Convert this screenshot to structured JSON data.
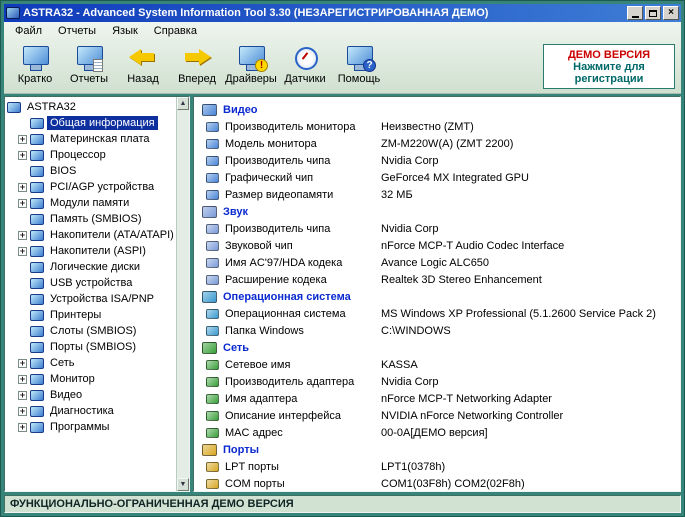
{
  "window": {
    "title": "ASTRA32 - Advanced System Information Tool 3.30 (НЕЗАРЕГИСТРИРОВАННАЯ ДЕМО)",
    "status_bar": "ФУНКЦИОНАЛЬНО-ОГРАНИЧЕННАЯ ДЕМО ВЕРСИЯ"
  },
  "menu": {
    "items": [
      {
        "label": "Файл"
      },
      {
        "label": "Отчеты"
      },
      {
        "label": "Язык"
      },
      {
        "label": "Справка"
      }
    ]
  },
  "toolbar": {
    "buttons": [
      {
        "label": "Кратко",
        "icon": "summary-icon",
        "type": "monitor"
      },
      {
        "label": "Отчеты",
        "icon": "reports-icon",
        "type": "monitor-page"
      },
      {
        "label": "Назад",
        "icon": "back-icon",
        "type": "arrow-left"
      },
      {
        "label": "Вперед",
        "icon": "forward-icon",
        "type": "arrow-right"
      },
      {
        "label": "Драйверы",
        "icon": "drivers-icon",
        "type": "monitor-warn"
      },
      {
        "label": "Датчики",
        "icon": "sensors-icon",
        "type": "gauge"
      },
      {
        "label": "Помощь",
        "icon": "help-icon",
        "type": "monitor-help"
      }
    ],
    "demo": {
      "line1": "ДЕМО ВЕРСИЯ",
      "line2": "Нажмите для регистрации"
    }
  },
  "tree": {
    "root": "ASTRA32",
    "items": [
      {
        "label": "Общая информация",
        "expandable": false,
        "selected": true
      },
      {
        "label": "Материнская плата",
        "expandable": true,
        "selected": false
      },
      {
        "label": "Процессор",
        "expandable": true,
        "selected": false
      },
      {
        "label": "BIOS",
        "expandable": false,
        "selected": false
      },
      {
        "label": "PCI/AGP устройства",
        "expandable": true,
        "selected": false
      },
      {
        "label": "Модули памяти",
        "expandable": true,
        "selected": false
      },
      {
        "label": "Память (SMBIOS)",
        "expandable": false,
        "selected": false
      },
      {
        "label": "Накопители (ATA/ATAPI)",
        "expandable": true,
        "selected": false
      },
      {
        "label": "Накопители (ASPI)",
        "expandable": true,
        "selected": false
      },
      {
        "label": "Логические диски",
        "expandable": false,
        "selected": false
      },
      {
        "label": "USB устройства",
        "expandable": false,
        "selected": false
      },
      {
        "label": "Устройства ISA/PNP",
        "expandable": false,
        "selected": false
      },
      {
        "label": "Принтеры",
        "expandable": false,
        "selected": false
      },
      {
        "label": "Слоты (SMBIOS)",
        "expandable": false,
        "selected": false
      },
      {
        "label": "Порты (SMBIOS)",
        "expandable": false,
        "selected": false
      },
      {
        "label": "Сеть",
        "expandable": true,
        "selected": false
      },
      {
        "label": "Монитор",
        "expandable": true,
        "selected": false
      },
      {
        "label": "Видео",
        "expandable": true,
        "selected": false
      },
      {
        "label": "Диагностика",
        "expandable": true,
        "selected": false
      },
      {
        "label": "Программы",
        "expandable": true,
        "selected": false
      }
    ]
  },
  "content": {
    "sections": [
      {
        "title": "Видео",
        "icon": "video",
        "icon_color": "#4a86d8",
        "rows": [
          {
            "label": "Производитель монитора",
            "value": "Неизвестно (ZMT)"
          },
          {
            "label": "Модель монитора",
            "value": "ZM-M220W(A) (ZMT 2200)"
          },
          {
            "label": "Производитель чипа",
            "value": "Nvidia Corp"
          },
          {
            "label": "Графический чип",
            "value": "GeForce4 MX Integrated GPU"
          },
          {
            "label": "Размер видеопамяти",
            "value": "32 МБ"
          }
        ]
      },
      {
        "title": "Звук",
        "icon": "sound",
        "icon_color": "#7a9ad8",
        "rows": [
          {
            "label": "Производитель чипа",
            "value": "Nvidia Corp"
          },
          {
            "label": "Звуковой чип",
            "value": "nForce MCP-T Audio Codec Interface"
          },
          {
            "label": "Имя AC'97/HDA кодека",
            "value": "Avance Logic ALC650"
          },
          {
            "label": "Расширение кодека",
            "value": "Realtek 3D Stereo Enhancement"
          }
        ]
      },
      {
        "title": "Операционная система",
        "icon": "os",
        "icon_color": "#3a9ad0",
        "rows": [
          {
            "label": "Операционная система",
            "value": "MS Windows XP Professional (5.1.2600 Service Pack 2)"
          },
          {
            "label": "Папка Windows",
            "value": "C:\\WINDOWS"
          }
        ]
      },
      {
        "title": "Сеть",
        "icon": "network",
        "icon_color": "#3aa03a",
        "rows": [
          {
            "label": "Сетевое имя",
            "value": "KASSA"
          },
          {
            "label": "Производитель адаптера",
            "value": "Nvidia Corp"
          },
          {
            "label": "Имя адаптера",
            "value": "nForce MCP-T Networking Adapter"
          },
          {
            "label": "Описание интерфейса",
            "value": "NVIDIA nForce Networking Controller"
          },
          {
            "label": "MAC адрес",
            "value": "00-0A[ДЕМО версия]"
          }
        ]
      },
      {
        "title": "Порты",
        "icon": "ports",
        "icon_color": "#d8a820",
        "rows": [
          {
            "label": "LPT порты",
            "value": "LPT1(0378h)"
          },
          {
            "label": "COM порты",
            "value": "COM1(03F8h) COM2(02F8h)"
          }
        ]
      }
    ]
  }
}
